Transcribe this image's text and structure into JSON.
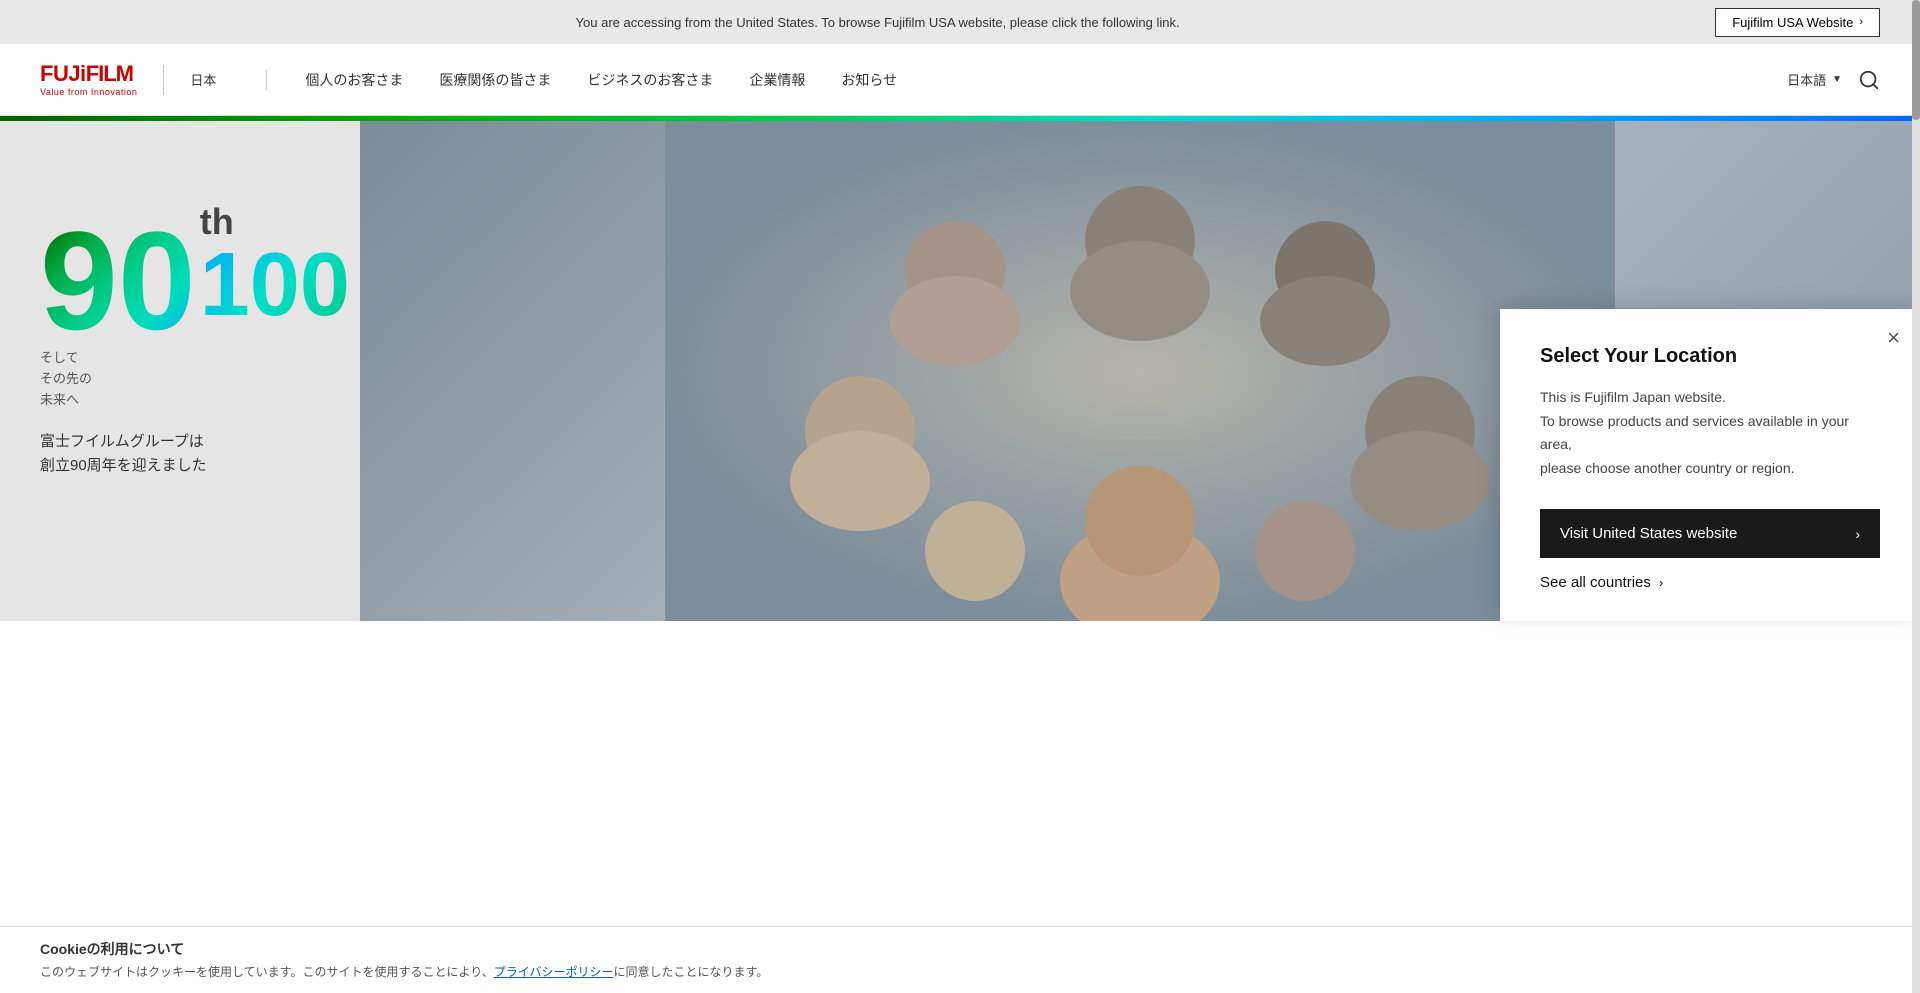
{
  "banner": {
    "text": "You are accessing from the United States. To browse Fujifilm USA website, please click the following link.",
    "btn_label": "Fujifilm USA Website",
    "btn_arrow": "›"
  },
  "header": {
    "logo_main": "FUJiFILM",
    "logo_sub": "Value from Innovation",
    "logo_jp": "日本",
    "nav_divider": "|",
    "nav_items": [
      "個人のお客さま",
      "医療関係の皆さま",
      "ビジネスのお客さま",
      "企業情報",
      "お知らせ"
    ],
    "lang": "日本語",
    "lang_arrow": "▼"
  },
  "hero": {
    "number": "90",
    "th": "th",
    "hundred": "100",
    "tagline_line1": "そして",
    "tagline_line2": "その先の",
    "tagline_line3": "未来へ",
    "desc_line1": "富士フイルムグループは",
    "desc_line2": "創立90周年を迎えました"
  },
  "popup": {
    "title": "Select Your Location",
    "close_symbol": "×",
    "desc_line1": "This is Fujifilm Japan website.",
    "desc_line2": "To browse products and services available in your area,",
    "desc_line3": "please choose another country or region.",
    "visit_btn": "Visit United States website",
    "visit_arrow": "›",
    "see_all": "See all countries",
    "see_all_arrow": "›"
  },
  "cookie": {
    "title": "Cookieの利用について",
    "text": "このウェブサイトはクッキーを使用しています。このサイトを使用することにより、",
    "link": "プライバシーポリシー",
    "text2": "に同意したことになります。"
  }
}
